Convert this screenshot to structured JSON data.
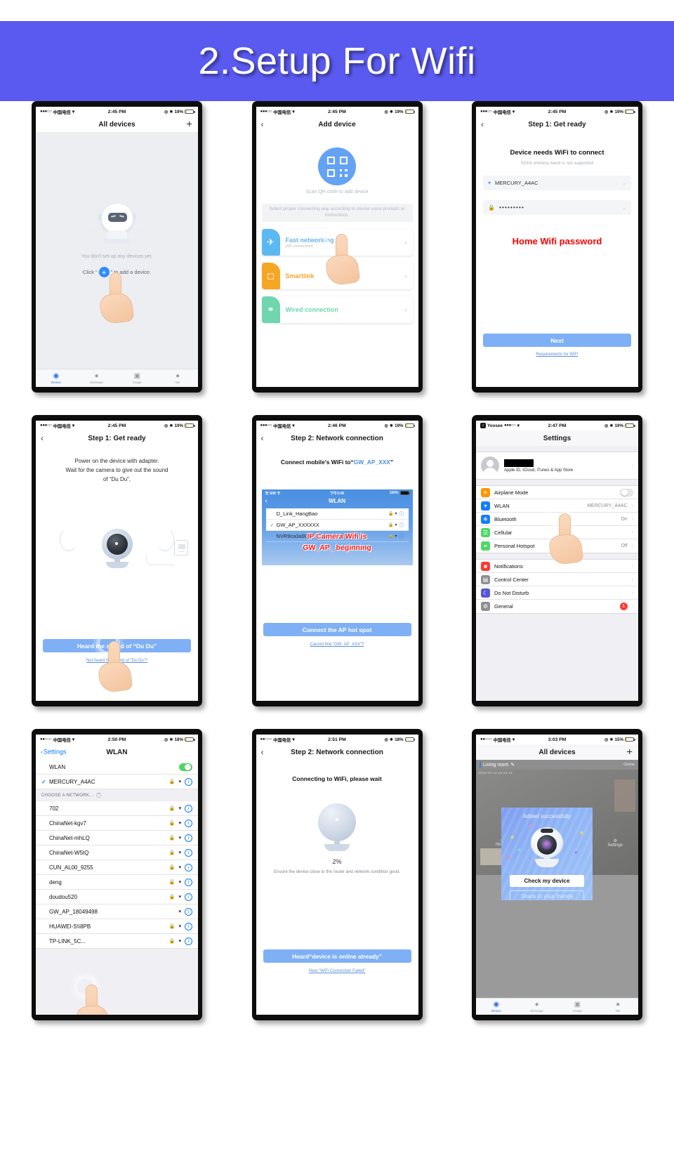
{
  "banner": {
    "title": "2.Setup For Wifi",
    "bg": "#5a5af0"
  },
  "screens": {
    "s1": {
      "status": {
        "dots": "●●●○○",
        "carrier": "中国电信",
        "wifi": "ᵟ",
        "time": "2:45 PM",
        "battery": "19%"
      },
      "nav_title": "All devices",
      "plus": "+",
      "empty_text": "You don't set up any devices yet.",
      "click_pre": "Click “",
      "click_post": "” to add a device.",
      "tabs": [
        {
          "label": "Device",
          "icon": "camera-icon"
        },
        {
          "label": "Message",
          "icon": "message-icon"
        },
        {
          "label": "Image",
          "icon": "image-icon"
        },
        {
          "label": "Me",
          "icon": "person-icon"
        }
      ]
    },
    "s2": {
      "status": {
        "dots": "●●●○○",
        "carrier": "中国电信",
        "time": "2:45 PM",
        "battery": "19%"
      },
      "nav_title": "Add device",
      "scan_caption": "Scan QR code to add device",
      "select_hint": "Select proper connecting way according to device voice prompts or instructions.",
      "options": [
        {
          "title": "Fast networking",
          "sub": "(AP connection)",
          "color": "#5cb8f0",
          "icon": "rocket-icon"
        },
        {
          "title": "Smartlink",
          "sub": "",
          "color": "#f5a623",
          "icon": "android-icon"
        },
        {
          "title": "Wired connection",
          "sub": "",
          "color": "#6fd6ae",
          "icon": "plug-icon"
        }
      ]
    },
    "s3": {
      "status": {
        "dots": "●●●○○",
        "carrier": "中国电信",
        "time": "2:45 PM",
        "battery": "19%"
      },
      "nav_title": "Step 1: Get ready",
      "heading": "Device needs WiFi to connect",
      "subheading": "5GHz wireless band is not supported",
      "ssid": "MERCURY_A4AC",
      "password": "•••••••••",
      "annotation": "Home Wifi password",
      "annotation_color": "#ff0000",
      "next_button": "Next",
      "link": "Requirements for WiFi"
    },
    "s4": {
      "status": {
        "dots": "●●●○○",
        "carrier": "中国电信",
        "time": "2:45 PM",
        "battery": "19%"
      },
      "nav_title": "Step 1: Get ready",
      "line1": "Power on the device with adapter.",
      "line2": "Wait for the camera to give out the sound",
      "line3": "of “Du Du”,",
      "button": "Heard the sound of “Du Du”",
      "link": "Not heard the sound of “Du Du”?"
    },
    "s5": {
      "status": {
        "dots": "●●●○○",
        "carrier": "中国电信",
        "time": "2:46 PM",
        "battery": "19%"
      },
      "nav_title": "Step 2: Network connection",
      "instruction_pre": "Connect mobile's WiFi to“",
      "instruction_hl": "GW_AP_XXX",
      "instruction_post": "”",
      "mock": {
        "status_left": "无 SIM 卡",
        "status_mid": "下午2:49",
        "status_right": "100%",
        "title": "WLAN",
        "rows": [
          {
            "name": "D_Link_HangBao",
            "checked": false,
            "highlight": true
          },
          {
            "name": "GW_AP_XXXXXX",
            "checked": true,
            "highlight": true
          },
          {
            "name": "NVR9ca3a90",
            "checked": false,
            "highlight": false
          }
        ]
      },
      "note_line1": "IP Camera Wifi is",
      "note_line2": "GW_AP_  beginning",
      "note_color": "#ff1111",
      "button": "Connect the AP hot spot",
      "link": "Cannot find “GW_AP_XXX”?"
    },
    "s6": {
      "status": {
        "app": "Yoosee",
        "dots": "●●●○○",
        "time": "2:47 PM",
        "battery": "19%"
      },
      "nav_title": "Settings",
      "account_sub": "Apple ID, iCloud, iTunes & App Store",
      "group1": [
        {
          "label": "Airplane Mode",
          "value": "",
          "control": "toggle-off",
          "icon": "airplane-icon",
          "color": "#ff9500"
        },
        {
          "label": "WLAN",
          "value": "MERCURY_A4AC",
          "control": "chevron",
          "icon": "wifi-icon",
          "color": "#147efb"
        },
        {
          "label": "Bluetooth",
          "value": "On",
          "control": "chevron",
          "icon": "bluetooth-icon",
          "color": "#147efb"
        },
        {
          "label": "Cellular",
          "value": "",
          "control": "chevron",
          "icon": "cellular-icon",
          "color": "#4cd964"
        },
        {
          "label": "Personal Hotspot",
          "value": "Off",
          "control": "chevron",
          "icon": "hotspot-icon",
          "color": "#4cd964"
        }
      ],
      "group2": [
        {
          "label": "Notifications",
          "value": "",
          "control": "chevron",
          "icon": "notifications-icon",
          "color": "#ff3b30"
        },
        {
          "label": "Control Center",
          "value": "",
          "control": "chevron",
          "icon": "control-center-icon",
          "color": "#8e8e93"
        },
        {
          "label": "Do Not Disturb",
          "value": "",
          "control": "chevron",
          "icon": "moon-icon",
          "color": "#5756d6"
        },
        {
          "label": "General",
          "value": "",
          "control": "badge",
          "badge": "1",
          "icon": "gear-icon",
          "color": "#8e8e93"
        }
      ]
    },
    "s7": {
      "status": {
        "dots": "●●○○○",
        "carrier": "中国电信",
        "time": "2:50 PM",
        "battery": "18%"
      },
      "back_label": "Settings",
      "nav_title": "WLAN",
      "wlan_toggle_label": "WLAN",
      "wlan_toggle_on": true,
      "connected": "MERCURY_A4AC",
      "section_header": "CHOOSE A NETWORK...",
      "networks": [
        {
          "name": "702",
          "locked": true
        },
        {
          "name": "ChinaNet-kgv7",
          "locked": true
        },
        {
          "name": "ChinaNet-mhLQ",
          "locked": true
        },
        {
          "name": "ChinaNet-W5tQ",
          "locked": true
        },
        {
          "name": "CUN_AL00_9255",
          "locked": true
        },
        {
          "name": "deng",
          "locked": true
        },
        {
          "name": "doudou520",
          "locked": true
        },
        {
          "name": "GW_AP_18049498",
          "locked": false
        },
        {
          "name": "HUAWEI-S\\\\8PB",
          "locked": true
        },
        {
          "name": "TP-LINK_5C...",
          "locked": true
        }
      ]
    },
    "s8": {
      "status": {
        "dots": "●●○○○",
        "carrier": "中国电信",
        "time": "2:51 PM",
        "battery": "18%"
      },
      "nav_title": "Step 2: Network connection",
      "heading": "Connecting to WiFi, please wait",
      "progress": "2%",
      "note": "Ensure the device close to the router and network condition good.",
      "button": "Heard“device is online already”",
      "link": "Hear “WiFi Connection Failed”"
    },
    "s9": {
      "status": {
        "dots": "●●○○○",
        "carrier": "中国电信",
        "time": "3:03 PM",
        "battery": "15%"
      },
      "nav_title": "All devices",
      "plus": "+",
      "room": "Living room",
      "online": "Online",
      "feed_timestamp": "2018-03-12 15:03:21",
      "modal_title": "Added successfully",
      "btn_check": "Check my device",
      "btn_share": "Share to your friends",
      "overlay_home": "Home",
      "overlay_settings": "Settings",
      "tabs": [
        {
          "label": "Device",
          "icon": "camera-icon"
        },
        {
          "label": "Message",
          "icon": "message-icon"
        },
        {
          "label": "Image",
          "icon": "image-icon"
        },
        {
          "label": "Me",
          "icon": "person-icon"
        }
      ]
    }
  }
}
